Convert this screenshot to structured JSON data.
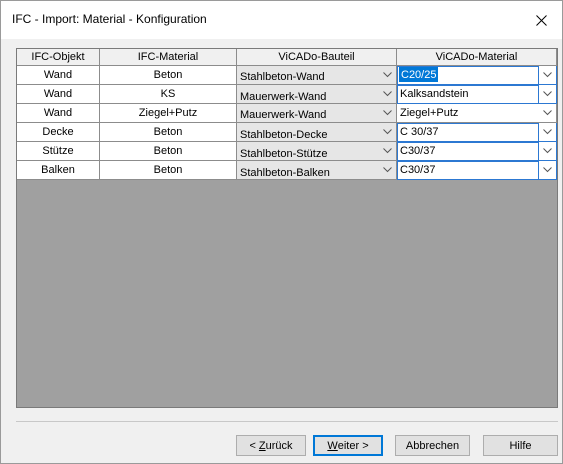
{
  "window": {
    "title": "IFC - Import: Material - Konfiguration"
  },
  "grid": {
    "headers": [
      "IFC-Objekt",
      "IFC-Material",
      "ViCADo-Bauteil",
      "ViCADo-Material"
    ],
    "rows": [
      {
        "objekt": "Wand",
        "material": "Beton",
        "bauteil": "Stahlbeton-Wand",
        "vicado_material": "C20/25"
      },
      {
        "objekt": "Wand",
        "material": "KS",
        "bauteil": "Mauerwerk-Wand",
        "vicado_material": "Kalksandstein"
      },
      {
        "objekt": "Wand",
        "material": "Ziegel+Putz",
        "bauteil": "Mauerwerk-Wand",
        "vicado_material": "Ziegel+Putz"
      },
      {
        "objekt": "Decke",
        "material": "Beton",
        "bauteil": "Stahlbeton-Decke",
        "vicado_material": "C 30/37"
      },
      {
        "objekt": "Stütze",
        "material": "Beton",
        "bauteil": "Stahlbeton-Stütze",
        "vicado_material": "C30/37"
      },
      {
        "objekt": "Balken",
        "material": "Beton",
        "bauteil": "Stahlbeton-Balken",
        "vicado_material": "C30/37"
      }
    ]
  },
  "buttons": {
    "back_prefix": "< ",
    "back_mnemonic": "Z",
    "back_rest": "urück",
    "next_mnemonic": "W",
    "next_rest": "eiter >",
    "cancel": "Abbrechen",
    "help": "Hilfe"
  },
  "colors": {
    "selection": "#0078d7",
    "grid_background": "#a0a0a0",
    "focus_border": "#2c78d2"
  },
  "icons": {
    "close": "close-icon",
    "dropdown": "chevron-down-icon"
  }
}
